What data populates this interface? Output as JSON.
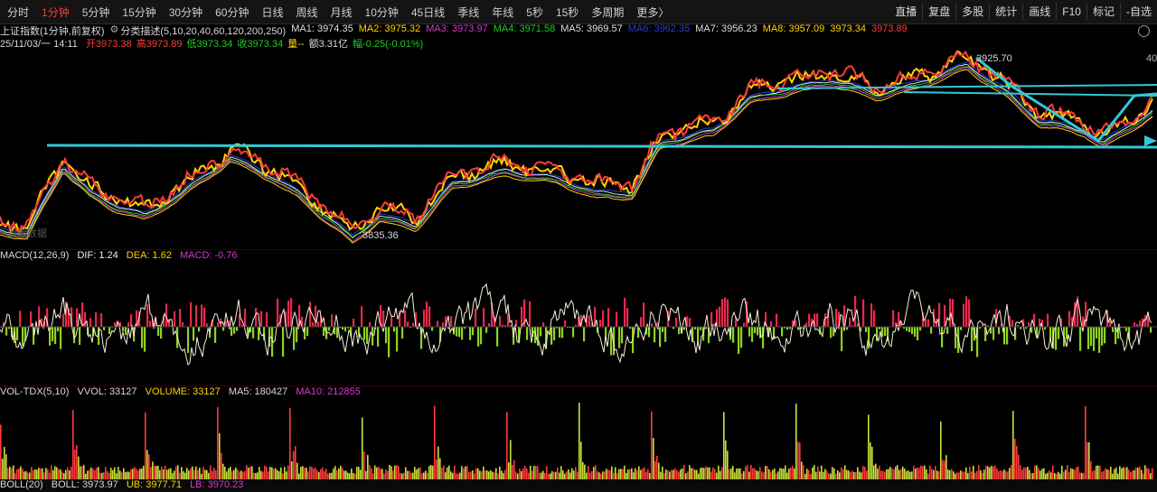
{
  "toolbar": {
    "periods": [
      "分时",
      "1分钟",
      "5分钟",
      "15分钟",
      "30分钟",
      "60分钟",
      "日线",
      "周线",
      "月线",
      "10分钟",
      "45日线",
      "季线",
      "年线",
      "5秒",
      "15秒",
      "多周期",
      "更多〉"
    ],
    "active_index": 1,
    "right_buttons": [
      "直播",
      "复盘",
      "多股",
      "统计",
      "画线",
      "F10",
      "标记",
      "-自选"
    ]
  },
  "info_line1": {
    "title": "上证指数(1分钟,前复权)",
    "indicator": "分类描述(5,10,20,40,60,120,200,250)",
    "ma": [
      {
        "label": "MA1: 3974.35",
        "color": "#e0e0e0"
      },
      {
        "label": "MA2: 3975.32",
        "color": "#ffd400"
      },
      {
        "label": "MA3: 3973.97",
        "color": "#d33cd3"
      },
      {
        "label": "MA4: 3971.58",
        "color": "#22cc22"
      },
      {
        "label": "MA5: 3969.57",
        "color": "#e0e0e0"
      },
      {
        "label": "MA6: 3962.35",
        "color": "#2b3bd8"
      },
      {
        "label": "MA7: 3956.23",
        "color": "#e0e0e0"
      },
      {
        "label": "MA8: 3957.09",
        "color": "#ffd400"
      },
      {
        "label": "3973.34",
        "color": "#ffd400"
      },
      {
        "label": "3973.89",
        "color": "#ff3b3b"
      }
    ]
  },
  "info_line2": {
    "date": "25/11/03/一 14:11",
    "open": "开3973.38",
    "high": "高3973.89",
    "low": "低3973.34",
    "close": "收3973.34",
    "vol": "量--",
    "amount": "额3.31亿",
    "change": "幅-0.25(-0.01%)"
  },
  "chart_labels": {
    "high_label": "3925.70",
    "low_label": "3835.36",
    "watermark": "到末数据",
    "y_tick": "40"
  },
  "macd": {
    "title": "MACD(12,26,9)",
    "dif": "DIF: 1.24",
    "dea": "DEA: 1.62",
    "macd": "MACD: -0.76"
  },
  "vol": {
    "title": "VOL-TDX(5,10)",
    "vvol": "VVOL: 33127",
    "volume": "VOLUME: 33127",
    "ma5": "MA5: 180427",
    "ma10": "MA10: 212855"
  },
  "boll": {
    "title": "BOLL(20)",
    "boll": "BOLL: 3973.97",
    "ub": "UB: 3977.71",
    "lb": "LB: 3970.23"
  },
  "colors": {
    "up": "#ff3b3b",
    "down": "#22cc22",
    "ma_yellow": "#ffd400",
    "trendline": "#33c8d8",
    "macd_pos": "#e8294c",
    "macd_neg": "#8fd121",
    "dif_line": "#f2f0d8"
  },
  "chart_data": [
    {
      "type": "line",
      "title": "上证指数(1分钟,前复权)",
      "annotations": [
        {
          "text": "3925.70",
          "kind": "high"
        },
        {
          "text": "3835.36",
          "kind": "low"
        }
      ],
      "series": [
        {
          "name": "MA1",
          "last": 3974.35
        },
        {
          "name": "MA2",
          "last": 3975.32
        },
        {
          "name": "MA3",
          "last": 3973.97
        },
        {
          "name": "MA4",
          "last": 3971.58
        },
        {
          "name": "MA5",
          "last": 3969.57
        },
        {
          "name": "MA6",
          "last": 3962.35
        },
        {
          "name": "MA7",
          "last": 3956.23
        },
        {
          "name": "MA8",
          "last": 3957.09
        }
      ]
    },
    {
      "type": "bar",
      "title": "MACD(12,26,9)",
      "series": [
        {
          "name": "DIF",
          "last": 1.24
        },
        {
          "name": "DEA",
          "last": 1.62
        },
        {
          "name": "MACD",
          "last": -0.76
        }
      ]
    },
    {
      "type": "bar",
      "title": "VOL-TDX(5,10)",
      "series": [
        {
          "name": "VOLUME",
          "last": 33127
        },
        {
          "name": "MA5",
          "last": 180427
        },
        {
          "name": "MA10",
          "last": 212855
        }
      ]
    }
  ]
}
